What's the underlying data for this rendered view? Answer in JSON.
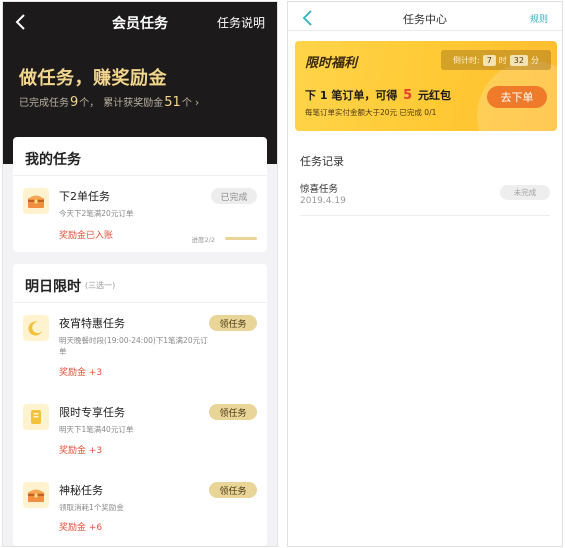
{
  "left": {
    "nav": {
      "title": "会员任务",
      "help": "任务说明"
    },
    "hero": {
      "headline": "做任务，赚奖励金",
      "completed_prefix": "已完成任务",
      "completed_count": "9",
      "completed_unit": "个，",
      "reward_prefix": "累计获奖励金",
      "reward_total": "51",
      "reward_unit": "个",
      "arrow": "›"
    },
    "my_tasks": {
      "title": "我的任务",
      "task": {
        "name": "下2单任务",
        "desc": "今天下2笔满20元订单",
        "reward": "奖励金已入账",
        "status": "已完成",
        "progress_label": "进度2/2",
        "progress": 1.0
      }
    },
    "tomorrow": {
      "title": "明日限时",
      "note": "(三选一)",
      "tasks": [
        {
          "name": "夜宵特惠任务",
          "desc": "明天晚餐时段(19:00-24:00)下1笔满20元订单",
          "reward": "奖励金 +3",
          "action": "领任务",
          "icon": "moon-icon"
        },
        {
          "name": "限时专享任务",
          "desc": "明天下1笔满40元订单",
          "reward": "奖励金 +3",
          "action": "领任务",
          "icon": "coupon-icon"
        },
        {
          "name": "神秘任务",
          "desc": "领取消耗1个奖励金",
          "reward": "奖励金 +6",
          "action": "领任务",
          "icon": "treasure-chest-icon"
        }
      ]
    }
  },
  "right": {
    "nav": {
      "title": "任务中心",
      "rules": "规则"
    },
    "promo": {
      "title": "限时福利",
      "countdown_label": "倒计时:",
      "hours": "7",
      "hours_unit": "时",
      "minutes": "32",
      "minutes_unit": "分",
      "main_prefix": "下 1 笔订单，可得",
      "main_amount": "5",
      "main_suffix": "元红包",
      "sub": "每笔订单实付金额大于20元 已完成 0/1",
      "button": "去下单"
    },
    "records": {
      "title": "任务记录",
      "items": [
        {
          "name": "惊喜任务",
          "date": "2019.4.19",
          "status": "未完成"
        }
      ]
    }
  },
  "colors": {
    "gold": "#f2d68c",
    "dark": "#1c1a1b",
    "reward_red": "#e5513b",
    "teal": "#2cb3bc",
    "orange_button": "#ef7a2a",
    "promo_yellow": "#ffc934"
  }
}
